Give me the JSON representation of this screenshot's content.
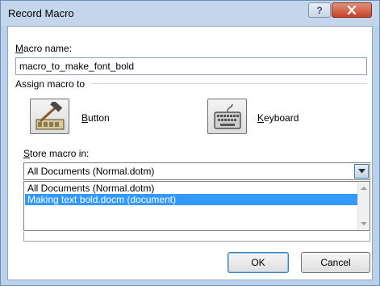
{
  "window": {
    "title": "Record Macro",
    "help_label": "?",
    "close_label": "x"
  },
  "macro_name": {
    "label_accel": "M",
    "label_rest": "acro name:",
    "value": "macro_to_make_font_bold"
  },
  "assign": {
    "heading": "Assign macro to",
    "button_label_accel": "B",
    "button_label_rest": "utton",
    "keyboard_label_accel": "K",
    "keyboard_label_rest": "eyboard"
  },
  "store": {
    "label_accel": "S",
    "label_rest": "tore macro in:",
    "selected": "All Documents (Normal.dotm)",
    "options": [
      "All Documents (Normal.dotm)",
      "Making text bold.docm (document)"
    ],
    "highlighted_index": 1
  },
  "footer": {
    "ok_label": "OK",
    "cancel_label": "Cancel"
  },
  "icons": {
    "help": "help-icon",
    "close": "close-icon",
    "button": "hammer-toolbar-icon",
    "keyboard": "keyboard-icon",
    "dropdown": "chevron-down-icon"
  }
}
